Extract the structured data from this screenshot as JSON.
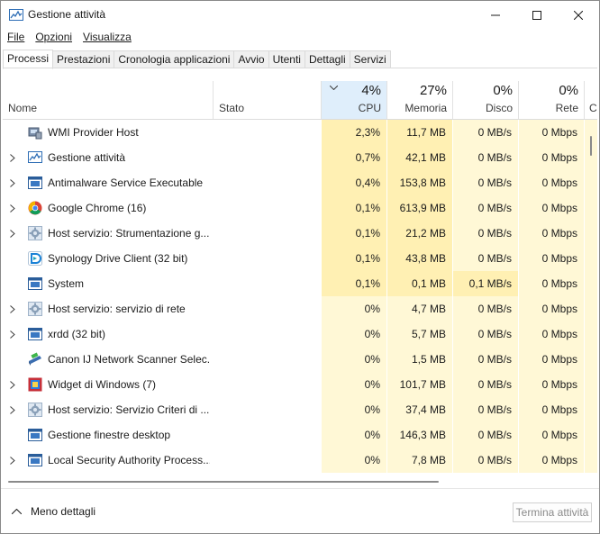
{
  "window": {
    "title": "Gestione attività"
  },
  "menu": [
    {
      "label": "File"
    },
    {
      "label": "Opzioni"
    },
    {
      "label": "Visualizza"
    }
  ],
  "tabs": [
    {
      "label": "Processi",
      "active": true
    },
    {
      "label": "Prestazioni"
    },
    {
      "label": "Cronologia applicazioni"
    },
    {
      "label": "Avvio"
    },
    {
      "label": "Utenti"
    },
    {
      "label": "Dettagli"
    },
    {
      "label": "Servizi"
    }
  ],
  "columns": {
    "name": "Nome",
    "status": "Stato",
    "cpu": {
      "pct": "4%",
      "label": "CPU"
    },
    "memory": {
      "pct": "27%",
      "label": "Memoria"
    },
    "disk": {
      "pct": "0%",
      "label": "Disco"
    },
    "network": {
      "pct": "0%",
      "label": "Rete"
    },
    "more": "Co"
  },
  "rows": [
    {
      "name": "WMI Provider Host",
      "expandable": false,
      "icon": "wmi-host-icon",
      "cpu": "2,3%",
      "memory": "11,7 MB",
      "disk": "0 MB/s",
      "network": "0 Mbps"
    },
    {
      "name": "Gestione attività",
      "expandable": true,
      "icon": "task-manager-icon",
      "cpu": "0,7%",
      "memory": "42,1 MB",
      "disk": "0 MB/s",
      "network": "0 Mbps"
    },
    {
      "name": "Antimalware Service Executable",
      "expandable": true,
      "icon": "service-window-icon",
      "cpu": "0,4%",
      "memory": "153,8 MB",
      "disk": "0 MB/s",
      "network": "0 Mbps"
    },
    {
      "name": "Google Chrome (16)",
      "expandable": true,
      "icon": "chrome-icon",
      "cpu": "0,1%",
      "memory": "613,9 MB",
      "disk": "0 MB/s",
      "network": "0 Mbps"
    },
    {
      "name": "Host servizio: Strumentazione g...",
      "expandable": true,
      "icon": "gear-icon",
      "cpu": "0,1%",
      "memory": "21,2 MB",
      "disk": "0 MB/s",
      "network": "0 Mbps"
    },
    {
      "name": "Synology Drive Client (32 bit)",
      "expandable": false,
      "icon": "synology-drive-icon",
      "cpu": "0,1%",
      "memory": "43,8 MB",
      "disk": "0 MB/s",
      "network": "0 Mbps"
    },
    {
      "name": "System",
      "expandable": false,
      "icon": "service-window-icon",
      "cpu": "0,1%",
      "memory": "0,1 MB",
      "disk": "0,1 MB/s",
      "network": "0 Mbps"
    },
    {
      "name": "Host servizio: servizio di rete",
      "expandable": true,
      "icon": "gear-icon",
      "cpu": "0%",
      "memory": "4,7 MB",
      "disk": "0 MB/s",
      "network": "0 Mbps"
    },
    {
      "name": "xrdd (32 bit)",
      "expandable": true,
      "icon": "service-window-icon",
      "cpu": "0%",
      "memory": "5,7 MB",
      "disk": "0 MB/s",
      "network": "0 Mbps"
    },
    {
      "name": "Canon IJ Network Scanner Selec...",
      "expandable": false,
      "icon": "scanner-icon",
      "cpu": "0%",
      "memory": "1,5 MB",
      "disk": "0 MB/s",
      "network": "0 Mbps"
    },
    {
      "name": "Widget di Windows (7)",
      "expandable": true,
      "icon": "widgets-icon",
      "cpu": "0%",
      "memory": "101,7 MB",
      "disk": "0 MB/s",
      "network": "0 Mbps"
    },
    {
      "name": "Host servizio: Servizio Criteri di ...",
      "expandable": true,
      "icon": "gear-icon",
      "cpu": "0%",
      "memory": "37,4 MB",
      "disk": "0 MB/s",
      "network": "0 Mbps"
    },
    {
      "name": "Gestione finestre desktop",
      "expandable": false,
      "icon": "service-window-icon",
      "cpu": "0%",
      "memory": "146,3 MB",
      "disk": "0 MB/s",
      "network": "0 Mbps"
    },
    {
      "name": "Local Security Authority Process...",
      "expandable": true,
      "icon": "service-window-icon",
      "cpu": "0%",
      "memory": "7,8 MB",
      "disk": "0 MB/s",
      "network": "0 Mbps"
    }
  ],
  "footer": {
    "less_details": "Meno dettagli",
    "end_task": "Termina attività"
  },
  "colors": {
    "cpu_header": "#dfeefb",
    "hot_high": "#fff0b3",
    "hot_low": "#fff8d6"
  }
}
